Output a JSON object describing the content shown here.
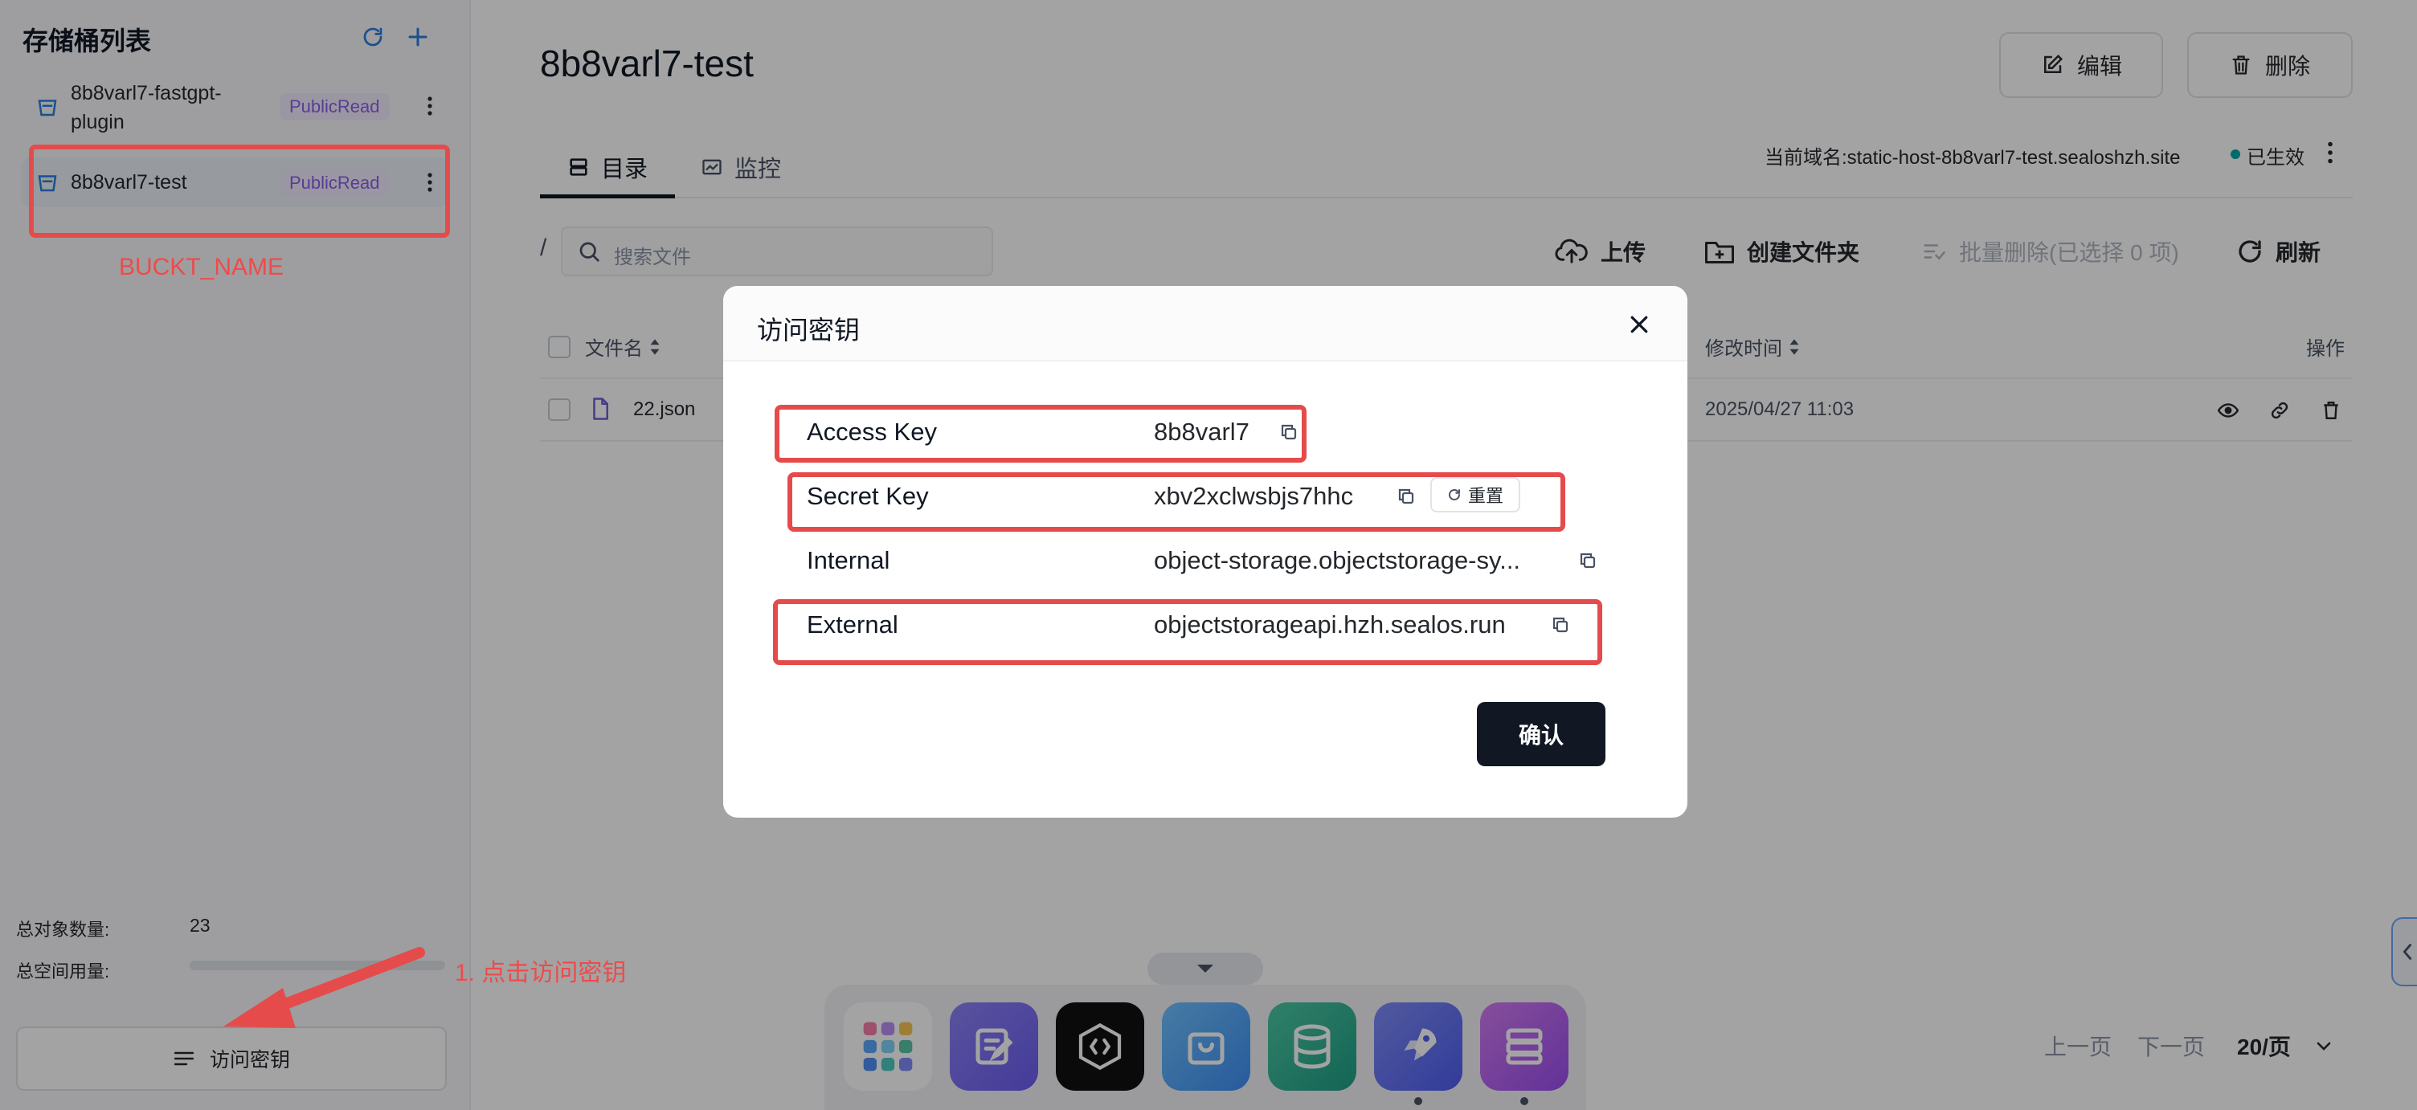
{
  "sidebar": {
    "title": "存储桶列表",
    "buckets": [
      {
        "name": "8b8varl7-fastgpt-plugin",
        "name_line1": "8b8varl7-fastgpt-",
        "name_line2": "plugin",
        "badge": "PublicRead"
      },
      {
        "name": "8b8varl7-test",
        "badge": "PublicRead"
      }
    ],
    "stats": {
      "objects_label": "总对象数量:",
      "objects_value": "23",
      "space_label": "总空间用量:"
    },
    "access_key_button": "访问密钥"
  },
  "main": {
    "title": "8b8varl7-test",
    "edit_button": "编辑",
    "delete_button": "删除",
    "tabs": [
      {
        "label": "目录",
        "active": true
      },
      {
        "label": "监控",
        "active": false
      }
    ],
    "domain_text": "当前域名:static-host-8b8varl7-test.sealoshzh.site",
    "domain_status": "已生效",
    "breadcrumb": "/",
    "search_placeholder": "搜索文件",
    "toolbar": {
      "upload": "上传",
      "new_folder": "创建文件夹",
      "batch_delete": "批量删除(已选择 0 项)",
      "refresh": "刷新"
    },
    "table": {
      "columns": {
        "name": "文件名",
        "modified": "修改时间",
        "actions": "操作"
      },
      "rows": [
        {
          "name": "22.json",
          "modified": "2025/04/27 11:03"
        }
      ]
    },
    "pagination": {
      "prev": "上一页",
      "next": "下一页",
      "page_size": "20/页"
    }
  },
  "modal": {
    "title": "访问密钥",
    "fields": [
      {
        "label": "Access Key",
        "value": "8b8varl7"
      },
      {
        "label": "Secret Key",
        "value": "xbv2xclwsbjs7hhc"
      },
      {
        "label": "Internal",
        "value": "object-storage.objectstorage-sy..."
      },
      {
        "label": "External",
        "value": "objectstorageapi.hzh.sealos.run"
      }
    ],
    "reset_button": "重置",
    "confirm_button": "确认"
  },
  "annotations": {
    "bucket_name_note": "BUCKT_NAME",
    "step_note": "1. 点击访问密钥"
  },
  "colors": {
    "annotation_red": "#e54b4b",
    "primary_dark": "#111824",
    "badge_purple": "#8d5fea",
    "status_teal": "#00a9a6"
  },
  "dock": {
    "apps": [
      "app-launcher-icon",
      "notes-app-icon",
      "devbox-app-icon",
      "app-store-icon",
      "database-app-icon",
      "app-launchpad-rocket-icon",
      "object-storage-app-icon"
    ]
  }
}
